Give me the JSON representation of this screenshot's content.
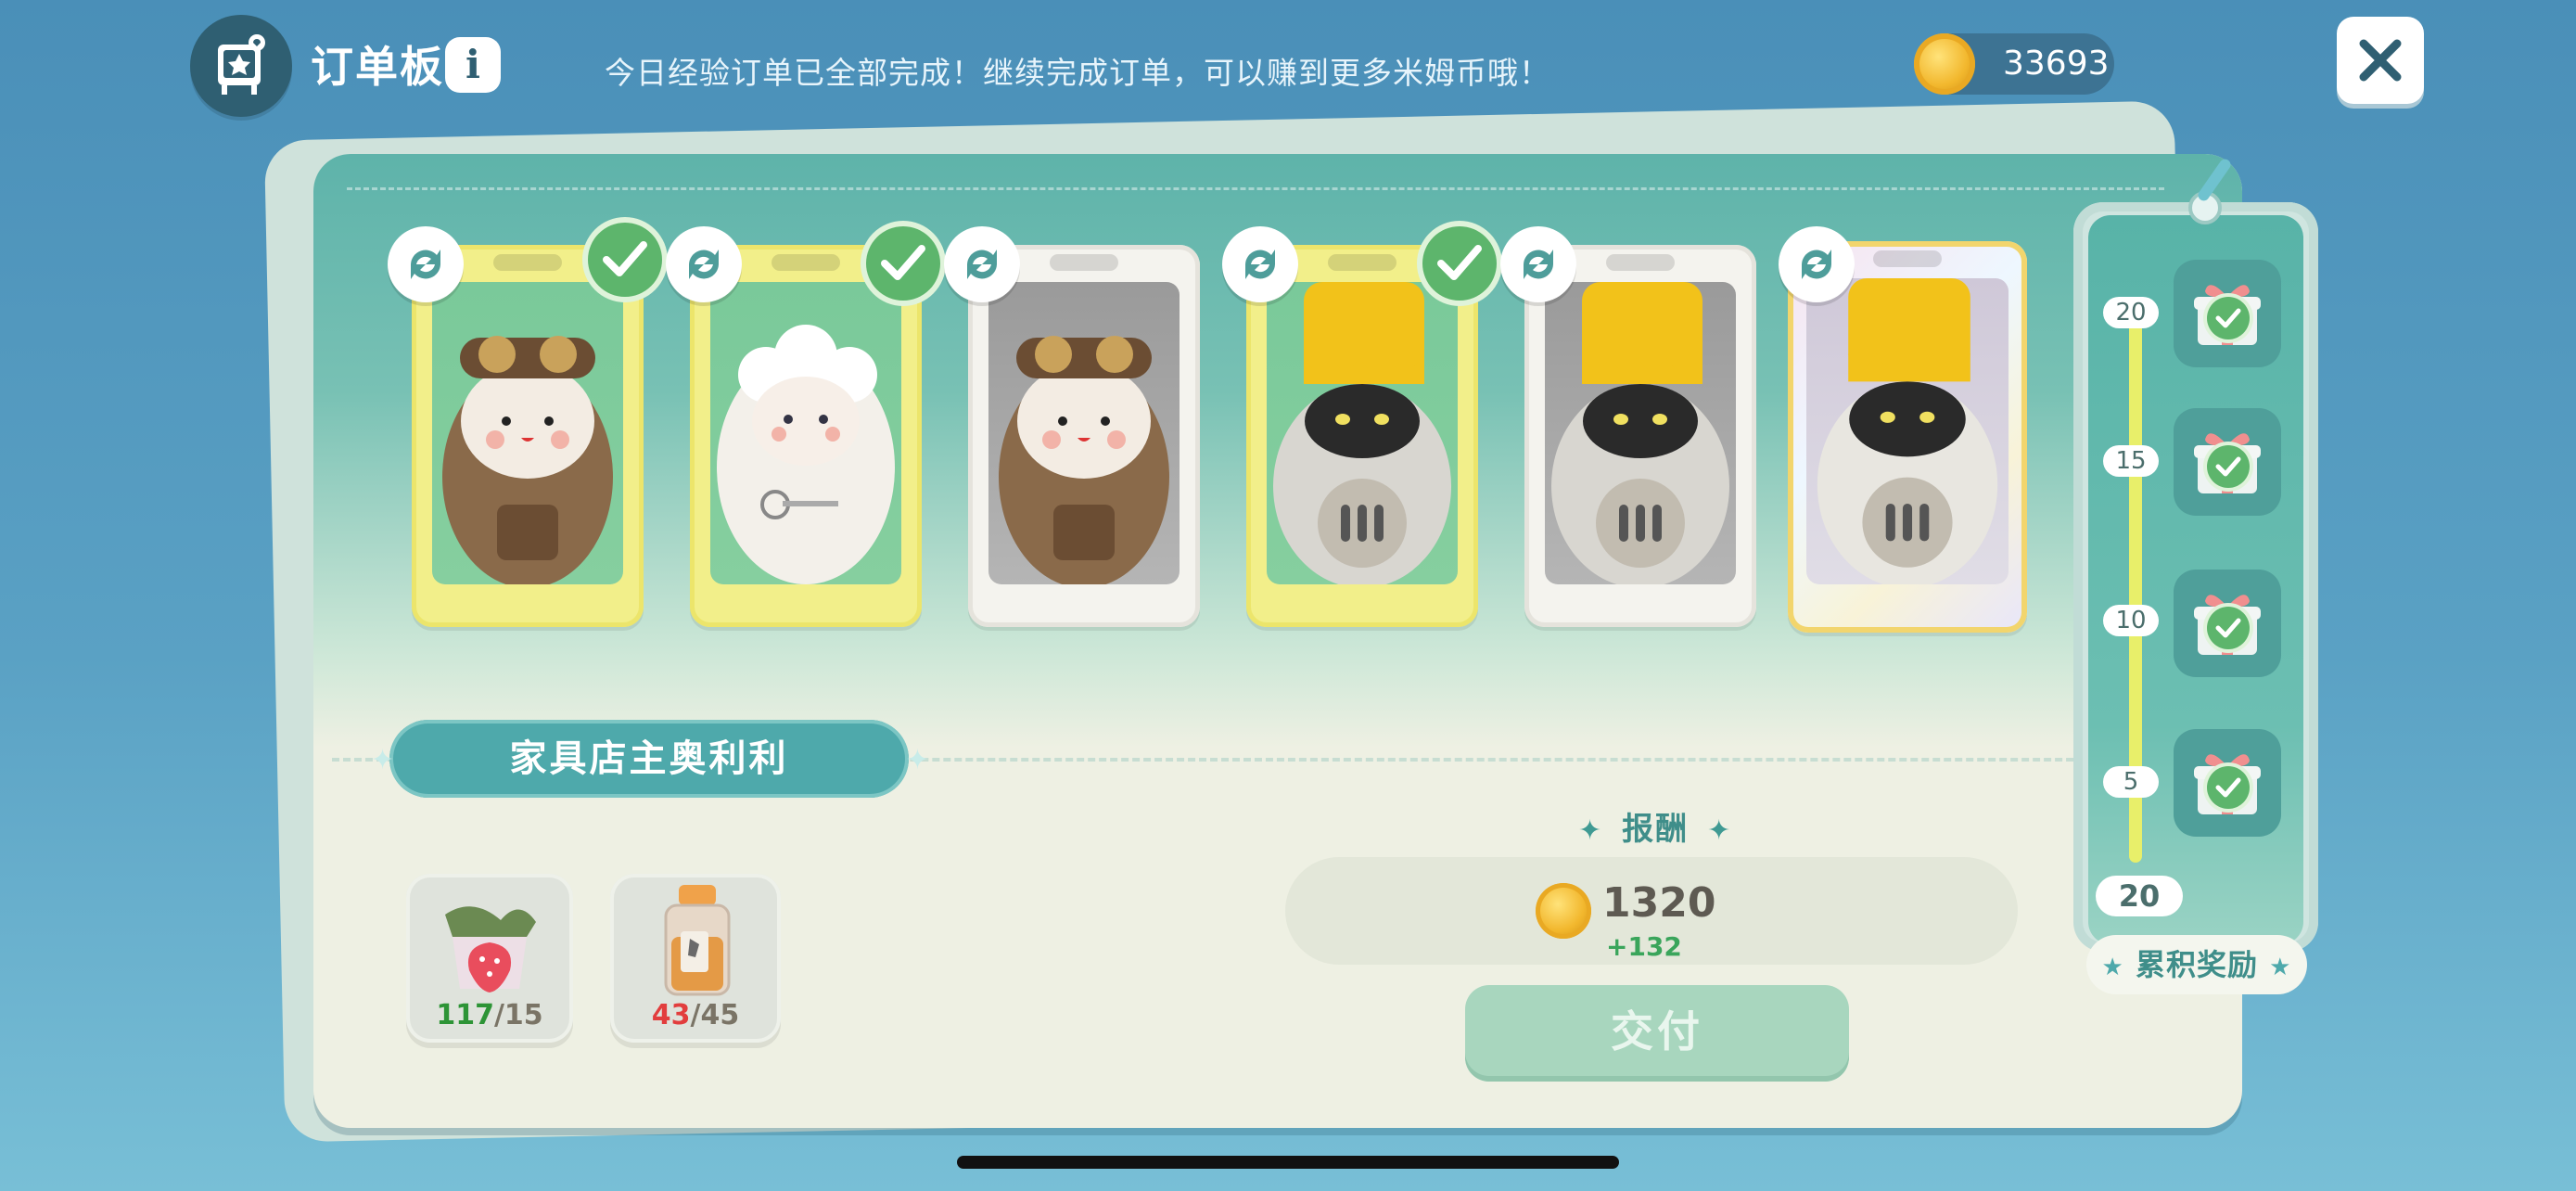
{
  "header": {
    "title": "订单板",
    "info_label": "i",
    "notice": "今日经验订单已全部完成！继续完成订单，可以赚到更多米姆币哦！",
    "coins": "33693"
  },
  "cards": [
    {
      "style": "gold",
      "art": "aviator-green",
      "completed": true
    },
    {
      "style": "gold",
      "art": "sheep-green",
      "completed": true
    },
    {
      "style": "white",
      "art": "aviator-grey",
      "completed": false
    },
    {
      "style": "gold",
      "art": "robot-green",
      "completed": true
    },
    {
      "style": "white",
      "art": "robot-grey",
      "completed": false
    },
    {
      "style": "rainbow",
      "art": "robot-pearl",
      "completed": false
    }
  ],
  "customer": {
    "name": "家具店主奥利利"
  },
  "materials": [
    {
      "icon": "strawberry-bag-icon",
      "have": "117",
      "need": "15",
      "enough": true
    },
    {
      "icon": "spice-jar-icon",
      "have": "43",
      "need": "45",
      "enough": false
    }
  ],
  "reward": {
    "title": "报酬",
    "amount": "1320",
    "bonus": "+132",
    "deliver_label": "交付"
  },
  "milestones": {
    "items": [
      {
        "label": "20",
        "claimed": true
      },
      {
        "label": "15",
        "claimed": true
      },
      {
        "label": "10",
        "claimed": true
      },
      {
        "label": "5",
        "claimed": true
      }
    ],
    "progress": "20",
    "button_label": "累积奖励"
  },
  "colors": {
    "accent": "#4ea9ab",
    "check": "#5db56c",
    "enough": "#2d9436",
    "lacking": "#e23d3d"
  }
}
